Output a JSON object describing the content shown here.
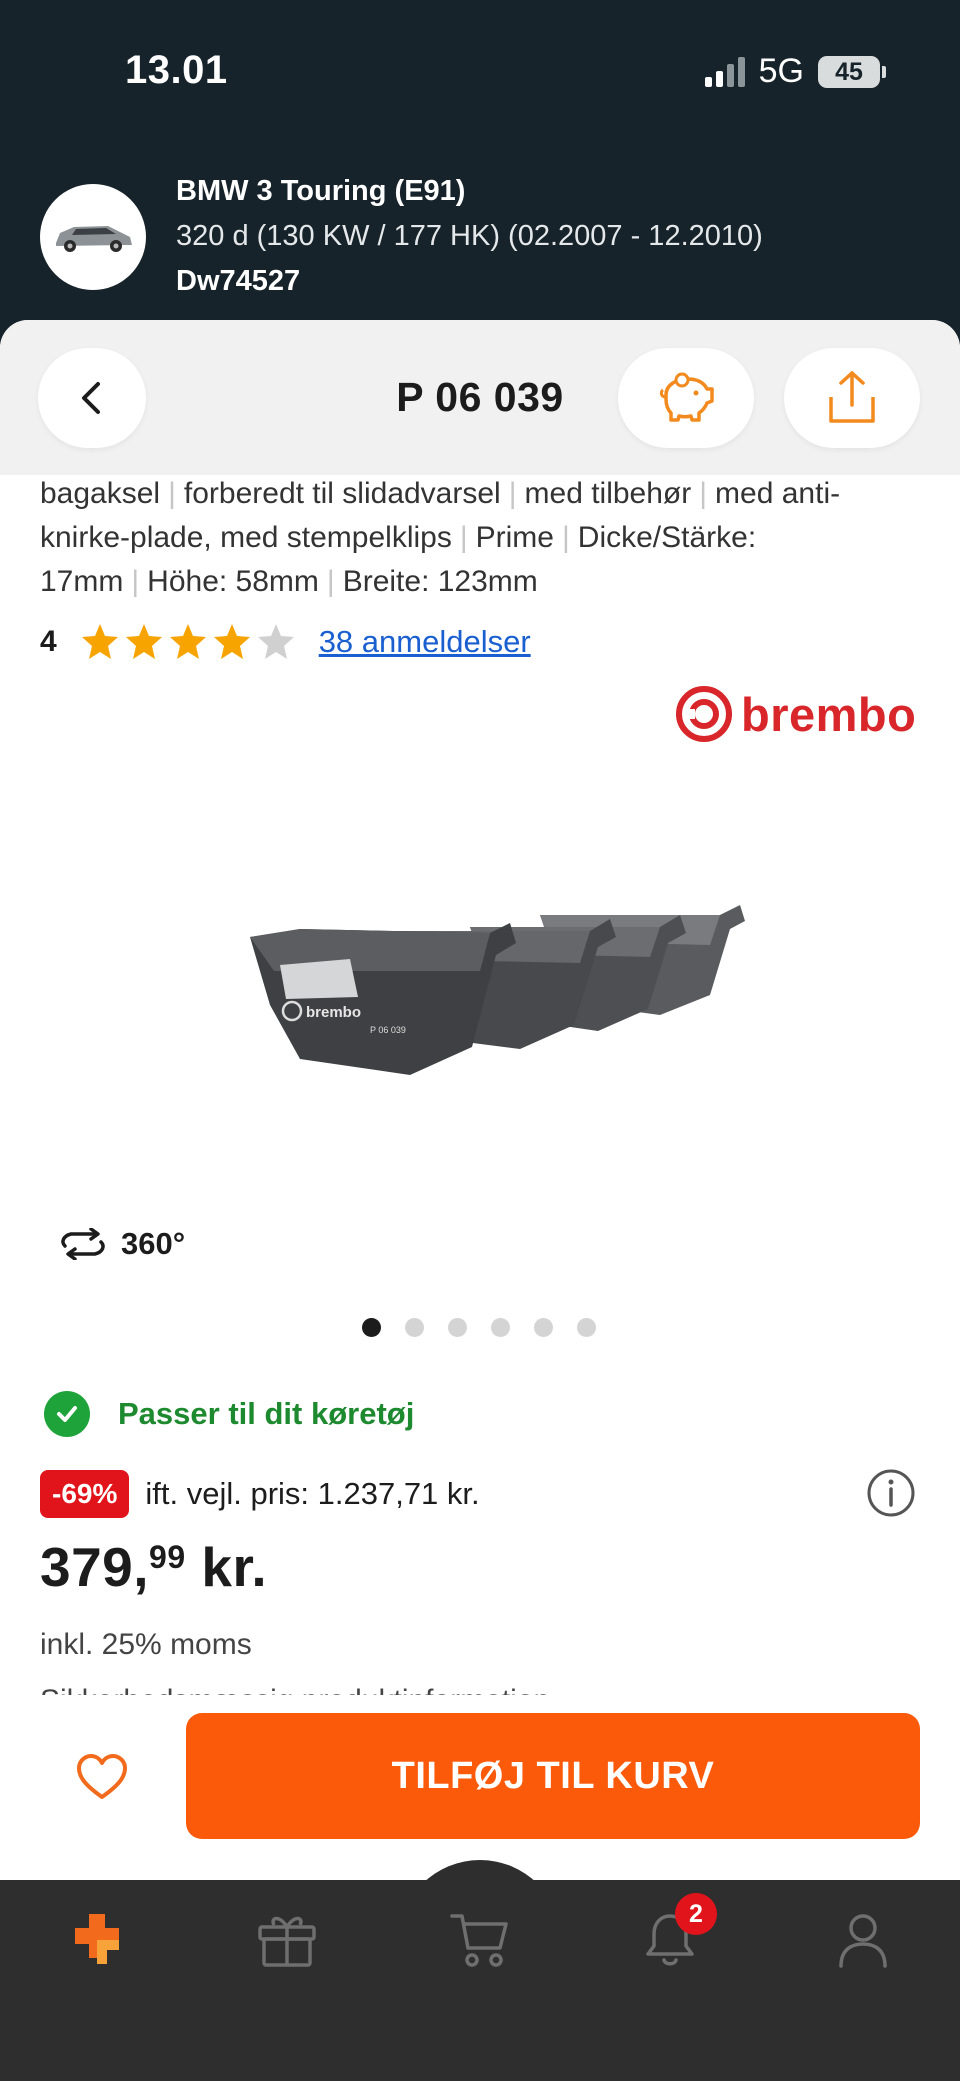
{
  "status_bar": {
    "time": "13.01",
    "network": "5G",
    "battery": "45"
  },
  "vehicle": {
    "name": "BMW 3 Touring (E91)",
    "spec": "320 d (130 KW / 177 HK) (02.2007 - 12.2010)",
    "code": "Dw74527"
  },
  "nav": {
    "title": "P 06 039"
  },
  "attributes": {
    "items": [
      "bagaksel",
      "forberedt til slidadvarsel",
      "med tilbehør",
      "med anti-knirke-plade, med stempelklips",
      "Prime",
      "Dicke/Stärke: 17mm",
      "Höhe: 58mm",
      "Breite: 123mm"
    ]
  },
  "rating": {
    "value": "4",
    "stars_filled": 4,
    "stars_total": 5,
    "reviews_link": "38 anmeldelser"
  },
  "brand": {
    "name": "brembo"
  },
  "gallery": {
    "rotate_label": "360°",
    "dots_total": 6,
    "active_dot": 1
  },
  "fitment": {
    "text": "Passer til dit køretøj"
  },
  "pricing": {
    "discount": "-69%",
    "rrp": "ift. vejl. pris: 1.237,71 kr.",
    "price_main": "379,",
    "price_decimals": "99",
    "price_unit": " kr.",
    "vat": "inkl. 25% moms",
    "safety_info": "Sikkerhedsmæssig produktinformation"
  },
  "actions": {
    "add_to_cart": "TILFØJ TIL KURV"
  },
  "tabbar": {
    "notifications_count": "2"
  },
  "colors": {
    "accent": "#fa5a0a",
    "header_bg": "#17232a",
    "success": "#1e8a2f",
    "discount": "#e2141b",
    "link": "#1a5fd0",
    "star": "#f7a400"
  }
}
